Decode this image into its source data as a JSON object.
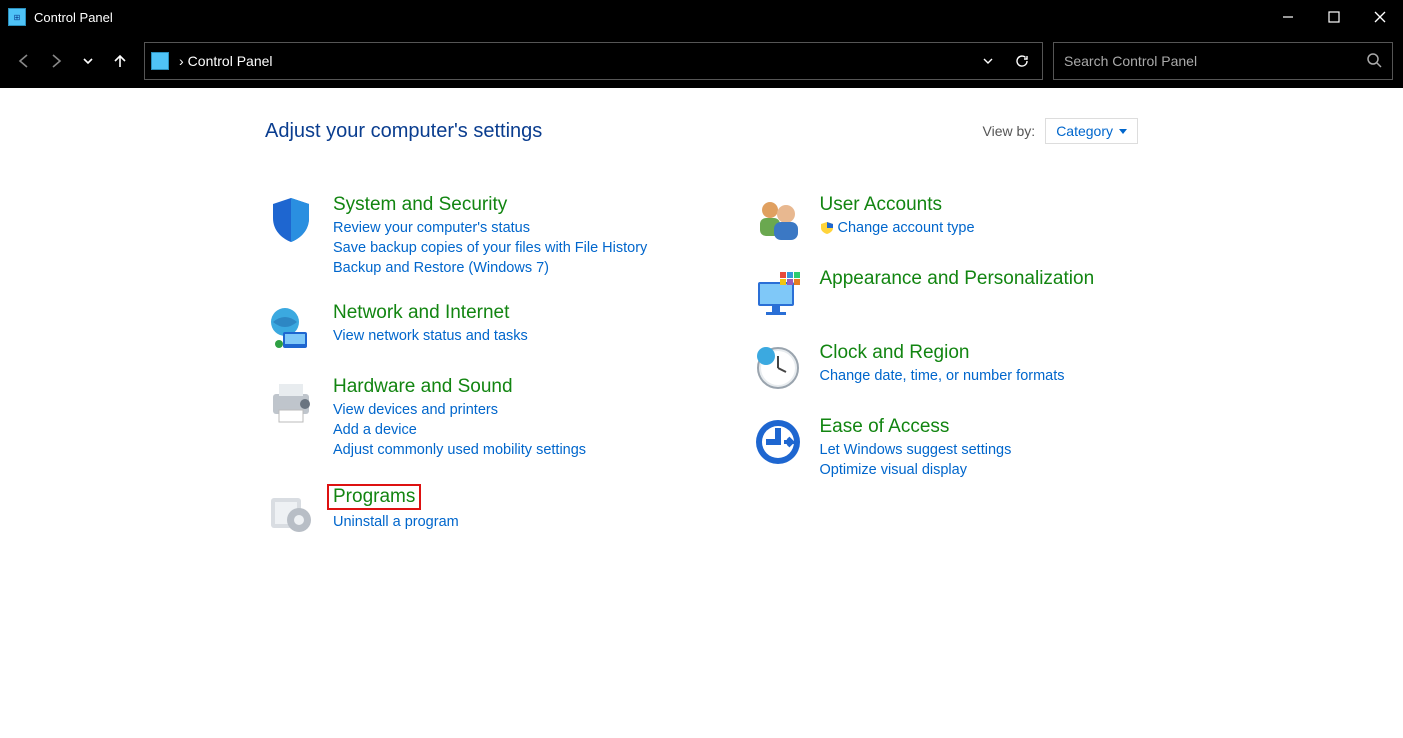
{
  "window": {
    "title": "Control Panel"
  },
  "breadcrumb": {
    "path": "Control Panel"
  },
  "search": {
    "placeholder": "Search Control Panel"
  },
  "page": {
    "heading": "Adjust your computer's settings",
    "viewby_label": "View by:",
    "viewby_value": "Category"
  },
  "left": {
    "system": {
      "title": "System and Security",
      "links": [
        "Review your computer's status",
        "Save backup copies of your files with File History",
        "Backup and Restore (Windows 7)"
      ]
    },
    "network": {
      "title": "Network and Internet",
      "links": [
        "View network status and tasks"
      ]
    },
    "hardware": {
      "title": "Hardware and Sound",
      "links": [
        "View devices and printers",
        "Add a device",
        "Adjust commonly used mobility settings"
      ]
    },
    "programs": {
      "title": "Programs",
      "links": [
        "Uninstall a program"
      ]
    }
  },
  "right": {
    "users": {
      "title": "User Accounts",
      "links": [
        "Change account type"
      ]
    },
    "appearance": {
      "title": "Appearance and Personalization",
      "links": []
    },
    "clock": {
      "title": "Clock and Region",
      "links": [
        "Change date, time, or number formats"
      ]
    },
    "ease": {
      "title": "Ease of Access",
      "links": [
        "Let Windows suggest settings",
        "Optimize visual display"
      ]
    }
  }
}
